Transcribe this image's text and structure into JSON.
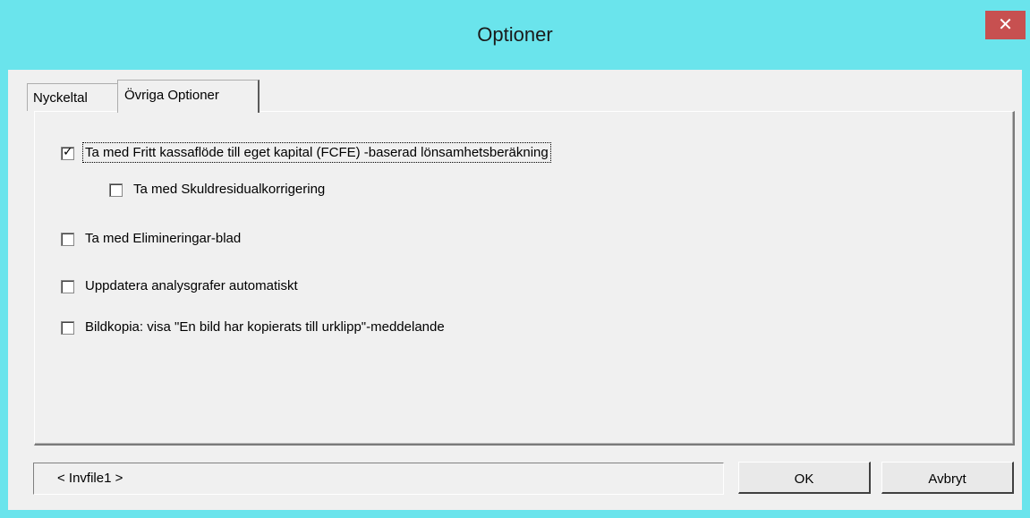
{
  "window": {
    "title": "Optioner",
    "close_glyph": "✕"
  },
  "tabs": [
    {
      "label": "Nyckeltal",
      "active": false
    },
    {
      "label": "Övriga Optioner",
      "active": true
    }
  ],
  "options": [
    {
      "label": "Ta med Fritt kassaflöde till eget kapital (FCFE) -baserad lönsamhetsberäkning",
      "checked": true
    },
    {
      "label": "Ta med Skuldresidualkorrigering",
      "checked": false
    },
    {
      "label": "Ta med Elimineringar-blad",
      "checked": false
    },
    {
      "label": "Uppdatera analysgrafer automatiskt",
      "checked": false
    },
    {
      "label": "Bildkopia: visa \"En bild har kopierats till urklipp\"-meddelande",
      "checked": false
    }
  ],
  "check_glyph": "✓",
  "status": {
    "text": "< Invfile1 >"
  },
  "buttons": {
    "ok": "OK",
    "cancel": "Avbryt"
  }
}
